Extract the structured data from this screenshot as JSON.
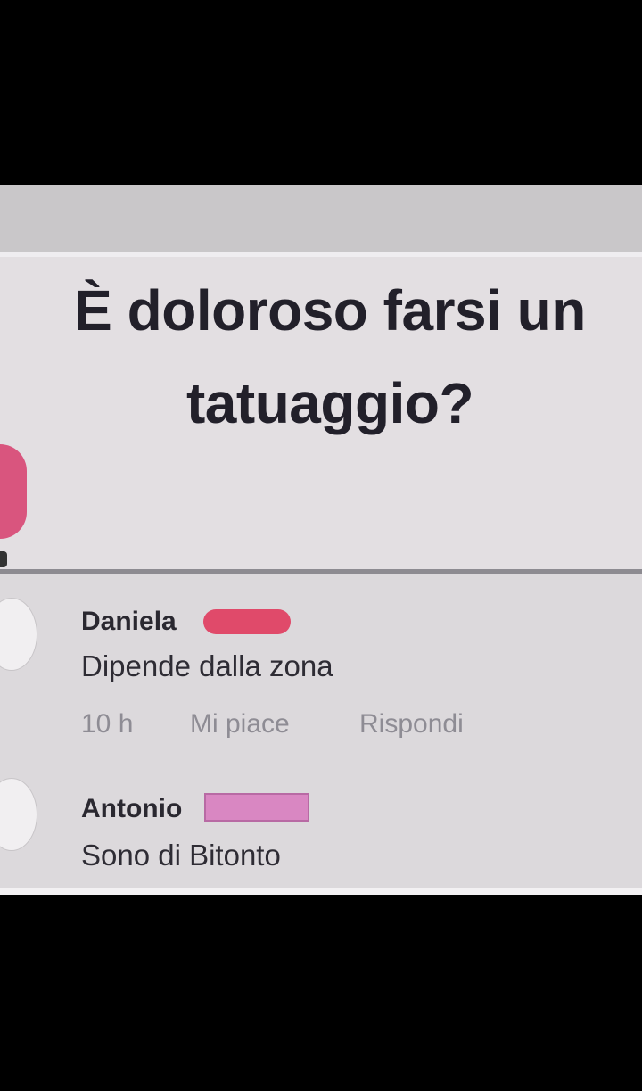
{
  "post": {
    "title": "È doloroso farsi un\ntatuaggio?"
  },
  "comments": [
    {
      "author": "Daniela",
      "text": "Dipende dalla zona",
      "time": "10 h",
      "like_label": "Mi piace",
      "reply_label": "Rispondi"
    },
    {
      "author": "Antonio",
      "text": "Sono di Bitonto"
    }
  ],
  "colors": {
    "background": "#000000",
    "card": "#e3dfe2",
    "title_text": "#22202a",
    "redaction_pink": "#e04a6a",
    "redaction_magenta": "#d987c2",
    "meta_text": "#8e8c94"
  }
}
